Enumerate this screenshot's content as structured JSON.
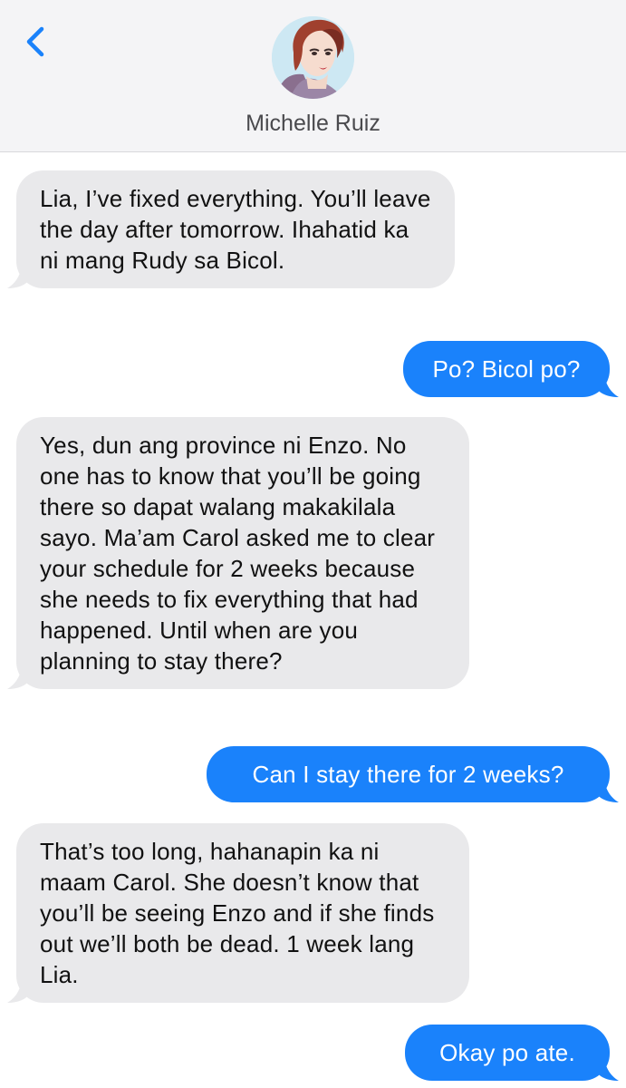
{
  "header": {
    "contact_name": "Michelle Ruiz",
    "back_icon": "chevron-left-icon",
    "avatar_icon": "contact-avatar"
  },
  "colors": {
    "incoming_bubble": "#e9e9eb",
    "outgoing_bubble": "#1a82fb",
    "accent": "#1a82fb",
    "header_bg": "#f4f4f6"
  },
  "messages": [
    {
      "direction": "incoming",
      "text": "Lia, I’ve fixed everything. You’ll leave the day after tomorrow. Ihahatid ka ni mang Rudy sa Bicol."
    },
    {
      "direction": "outgoing",
      "text": "Po? Bicol po?"
    },
    {
      "direction": "incoming",
      "text": "Yes, dun ang province ni Enzo. No one has to know that you’ll be going there so dapat walang makakilala sayo. Ma’am Carol asked me to clear your schedule for 2 weeks because she needs to fix everything that had happened. Until when are you planning to stay there?"
    },
    {
      "direction": "outgoing",
      "text": "Can I stay there for 2 weeks?"
    },
    {
      "direction": "incoming",
      "text": "That’s too long, hahanapin ka ni maam Carol. She doesn’t know that you’ll be seeing Enzo and if she finds out we’ll both be dead. 1 week lang Lia."
    },
    {
      "direction": "outgoing",
      "text": "Okay po ate."
    }
  ]
}
